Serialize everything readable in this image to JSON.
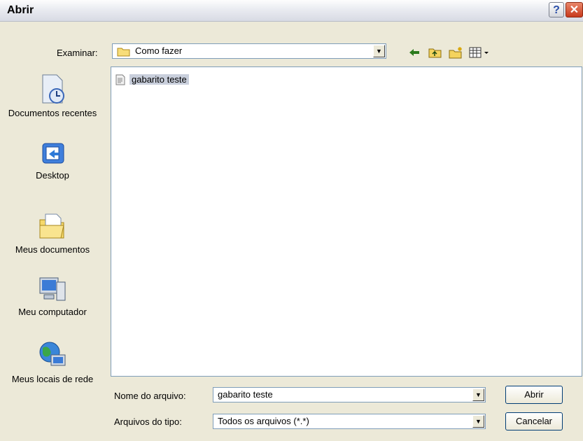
{
  "window": {
    "title": "Abrir"
  },
  "toolbar": {
    "look_in_label": "Examinar:",
    "look_in_value": "Como fazer",
    "icons": [
      "back-icon",
      "up-folder-icon",
      "new-folder-icon",
      "views-menu-icon"
    ]
  },
  "places": [
    {
      "label": "Documentos recentes",
      "icon": "recent-documents-icon"
    },
    {
      "label": "Desktop",
      "icon": "desktop-icon"
    },
    {
      "label": "Meus documentos",
      "icon": "my-documents-icon"
    },
    {
      "label": "Meu computador",
      "icon": "my-computer-icon"
    },
    {
      "label": "Meus locais de rede",
      "icon": "network-places-icon"
    }
  ],
  "files": [
    {
      "name": "gabarito teste",
      "icon": "text-file-icon",
      "selected": true
    }
  ],
  "filename": {
    "label": "Nome do arquivo:",
    "value": "gabarito teste"
  },
  "filetype": {
    "label": "Arquivos do tipo:",
    "value": "Todos os arquivos (*.*)"
  },
  "buttons": {
    "open": "Abrir",
    "cancel": "Cancelar"
  }
}
